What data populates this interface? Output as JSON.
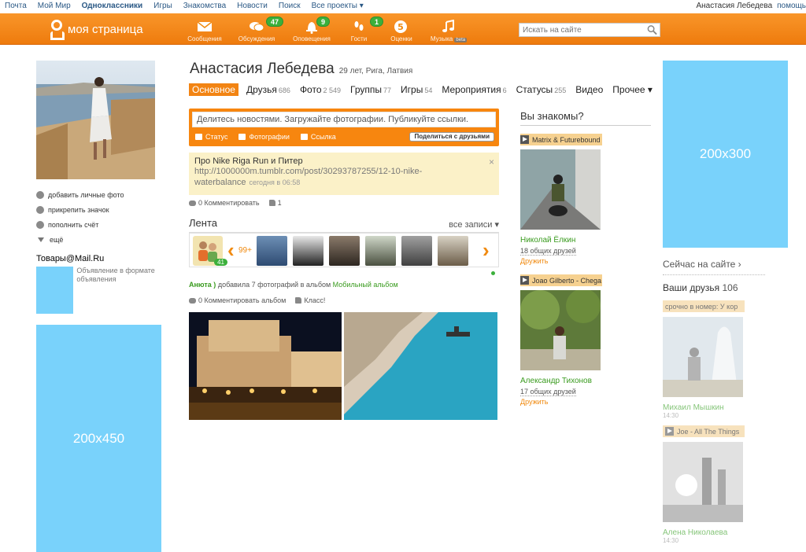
{
  "portal": {
    "links": [
      "Почта",
      "Мой Мир",
      "Одноклассники",
      "Игры",
      "Знакомства",
      "Новости",
      "Поиск",
      "Все проекты ▾"
    ],
    "user": "Анастасия Лебедева",
    "help": "помощь"
  },
  "toolbar": {
    "logo_text": "моя страница",
    "nav": [
      {
        "label": "Сообщения",
        "icon": "envelope-icon",
        "badge": ""
      },
      {
        "label": "Обсуждения",
        "icon": "chat-icon",
        "badge": "47"
      },
      {
        "label": "Оповещения",
        "icon": "bell-icon",
        "badge": "9"
      },
      {
        "label": "Гости",
        "icon": "footprints-icon",
        "badge": "1"
      },
      {
        "label": "Оценки",
        "icon": "rating-icon",
        "badge": ""
      },
      {
        "label": "Музыка",
        "icon": "music-icon",
        "badge": "",
        "beta": "beta"
      }
    ],
    "search_placeholder": "Искать на сайте"
  },
  "left": {
    "actions": [
      "добавить личные фото",
      "прикрепить значок",
      "пополнить счёт",
      "ещё"
    ],
    "goods_title": "Товары@Mail.Ru",
    "goods_text": "Объявление в формате объявления",
    "ad_label": "200x450"
  },
  "profile": {
    "name": "Анастасия Лебедева",
    "meta": "29 лет, Рига, Латвия",
    "tabs": [
      {
        "label": "Основное",
        "count": ""
      },
      {
        "label": "Друзья",
        "count": "686"
      },
      {
        "label": "Фото",
        "count": "2 549"
      },
      {
        "label": "Группы",
        "count": "77"
      },
      {
        "label": "Игры",
        "count": "54"
      },
      {
        "label": "Мероприятия",
        "count": "6"
      },
      {
        "label": "Статусы",
        "count": "255"
      },
      {
        "label": "Видео",
        "count": ""
      },
      {
        "label": "Прочее ▾",
        "count": ""
      }
    ]
  },
  "share": {
    "placeholder": "Делитесь новостями. Загружайте фотографии. Публикуйте ссылки.",
    "opt_status": "Статус",
    "opt_photos": "Фотографии",
    "opt_link": "Ссылка",
    "button": "Поделиться с друзьями"
  },
  "note": {
    "title": "Про Nike Riga Run и Питер",
    "link": "http://1000000m.tumblr.com/post/30293787255/12-10-nike-waterbalance",
    "date": "сегодня в 06:58",
    "comments": "0 Комментировать",
    "likes": "1"
  },
  "feed": {
    "title": "Лента",
    "all": "все записи ▾",
    "my_badge": "41",
    "more": "99+",
    "post_author": "Анюта )",
    "post_text": " добавила 7 фотографий в альбом ",
    "post_album": "Мобильный альбом",
    "post_comments": "0 Комментировать альбом",
    "post_like": "Класс!"
  },
  "dyk": {
    "title": "Вы знакомы?",
    "people": [
      {
        "music": "Matrix & Futurebound",
        "name": "Николай Ёлкин",
        "mutual": "18 общих друзей",
        "add": "Дружить"
      },
      {
        "music": "Joao Gilberto - Chega",
        "name": "Александр Тихонов",
        "mutual": "17 общих друзей",
        "add": "Дружить"
      }
    ]
  },
  "right": {
    "ad_label": "200x300",
    "online": "Сейчас на сайте ›",
    "friends_title": "Ваши друзья",
    "friends_count": "106",
    "friends": [
      {
        "music": "срочно в номер: У кор",
        "name": "Михаил Мышкин",
        "time": "14:30"
      },
      {
        "music": "Joe - All The Things",
        "name": "Алена Николаева",
        "time": "14:30"
      }
    ]
  },
  "colors": {
    "accent": "#f28413",
    "ad": "#79d2fb",
    "link_green": "#3a9b1f"
  }
}
